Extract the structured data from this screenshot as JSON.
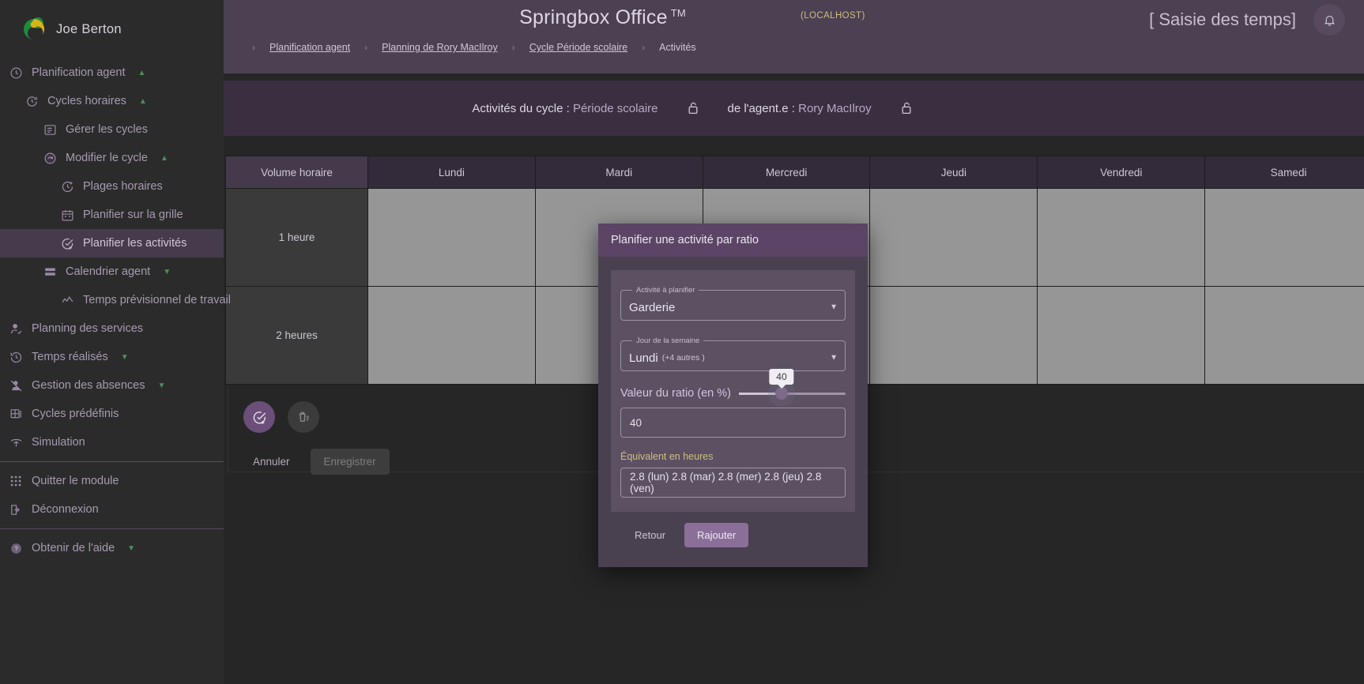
{
  "sidebar": {
    "user": "Joe Berton",
    "logo_icon": "springbox-logo-icon",
    "items": [
      {
        "label": "Planification agent",
        "level": 0,
        "icon": "clock-icon",
        "chevron": "up",
        "active": false
      },
      {
        "label": "Cycles horaires",
        "level": 1,
        "icon": "cycle-icon",
        "chevron": "up",
        "active": false
      },
      {
        "label": "Gérer les cycles",
        "level": 2,
        "icon": "list-icon",
        "chevron": "",
        "active": false
      },
      {
        "label": "Modifier le cycle",
        "level": 2,
        "icon": "edit-cycle-icon",
        "chevron": "up",
        "active": false
      },
      {
        "label": "Plages horaires",
        "level": 3,
        "icon": "clock-plus-icon",
        "chevron": "",
        "active": false
      },
      {
        "label": "Planifier sur la grille",
        "level": 3,
        "icon": "calendar-icon",
        "chevron": "",
        "active": false
      },
      {
        "label": "Planifier les activités",
        "level": 3,
        "icon": "check-plus-icon",
        "chevron": "",
        "active": true
      },
      {
        "label": "Calendrier agent",
        "level": 2,
        "icon": "rows-icon",
        "chevron": "down",
        "active": false
      },
      {
        "label": "Temps prévisionnel de travail",
        "level": 3,
        "icon": "trend-icon",
        "chevron": "",
        "active": false
      },
      {
        "label": "Planning des services",
        "level": 0,
        "icon": "user-check-icon",
        "chevron": "",
        "active": false
      },
      {
        "label": "Temps réalisés",
        "level": 0,
        "icon": "history-icon",
        "chevron": "down",
        "active": false
      },
      {
        "label": "Gestion des absences",
        "level": 0,
        "icon": "absence-icon",
        "chevron": "down",
        "active": false
      },
      {
        "label": "Cycles prédéfinis",
        "level": 0,
        "icon": "grid-box-icon",
        "chevron": "",
        "active": false
      },
      {
        "label": "Simulation",
        "level": 0,
        "icon": "simulation-icon",
        "chevron": "",
        "active": false
      },
      {
        "label": "Quitter le module",
        "level": 0,
        "icon": "apps-grid-icon",
        "chevron": "",
        "active": false
      },
      {
        "label": "Déconnexion",
        "level": 0,
        "icon": "logout-icon",
        "chevron": "",
        "active": false
      },
      {
        "label": "Obtenir de l'aide",
        "level": 0,
        "icon": "help-icon",
        "chevron": "down",
        "active": false
      }
    ]
  },
  "header": {
    "app_title": "Springbox Office",
    "trademark": "TM",
    "host": "(LOCALHOST)",
    "module_label": "[ Saisie des temps]",
    "module_icon": "calendar-check-icon",
    "bell_icon": "bell-icon",
    "breadcrumb": [
      {
        "label": "Planification agent",
        "link": true
      },
      {
        "label": "Planning de Rory MacIlroy",
        "link": true
      },
      {
        "label": "Cycle Période scolaire",
        "link": true
      },
      {
        "label": "Activités",
        "link": false
      }
    ]
  },
  "banner": {
    "cycle_prefix": "Activités du cycle :",
    "cycle_name": "Période scolaire",
    "cycle_lock_icon": "unlock-icon",
    "agent_prefix": "de l'agent.e :",
    "agent_name": "Rory MacIlroy",
    "agent_lock_icon": "unlock-icon"
  },
  "table": {
    "columns": [
      "Volume horaire",
      "Lundi",
      "Mardi",
      "Mercredi",
      "Jeudi",
      "Vendredi",
      "Samedi"
    ],
    "rows": [
      {
        "label": "1 heure",
        "cells": [
          "",
          "",
          "",
          "",
          "",
          "hatched"
        ]
      },
      {
        "label": "2 heures",
        "cells": [
          "",
          "",
          "",
          "",
          "",
          "hatched"
        ]
      }
    ]
  },
  "actions": {
    "add_activity_icon": "check-plus-icon",
    "delete_icon": "trash-icon",
    "cancel_label": "Annuler",
    "save_label": "Enregistrer"
  },
  "modal": {
    "title": "Planifier une activité par ratio",
    "activity_field": {
      "legend": "Activité à planifier",
      "value": "Garderie",
      "caret_icon": "chevron-down-icon"
    },
    "day_field": {
      "legend": "Jour de la semaine",
      "value": "Lundi",
      "extra": "(+4 autres )",
      "caret_icon": "chevron-down-icon"
    },
    "ratio": {
      "label": "Valeur du ratio (en %)",
      "tooltip": "40",
      "input_value": "40",
      "percent": 40
    },
    "equivalent": {
      "label": "Équivalent en heures",
      "value": "2.8 (lun) 2.8 (mar) 2.8 (mer) 2.8 (jeu) 2.8 (ven)"
    },
    "back_label": "Retour",
    "confirm_label": "Rajouter"
  },
  "colors": {
    "accent": "#8b6f98",
    "header_bg": "#4c4053",
    "sidebar_bg": "#2b2b2b",
    "modal_bg": "#4a4150",
    "gold": "#cdbf7e"
  }
}
